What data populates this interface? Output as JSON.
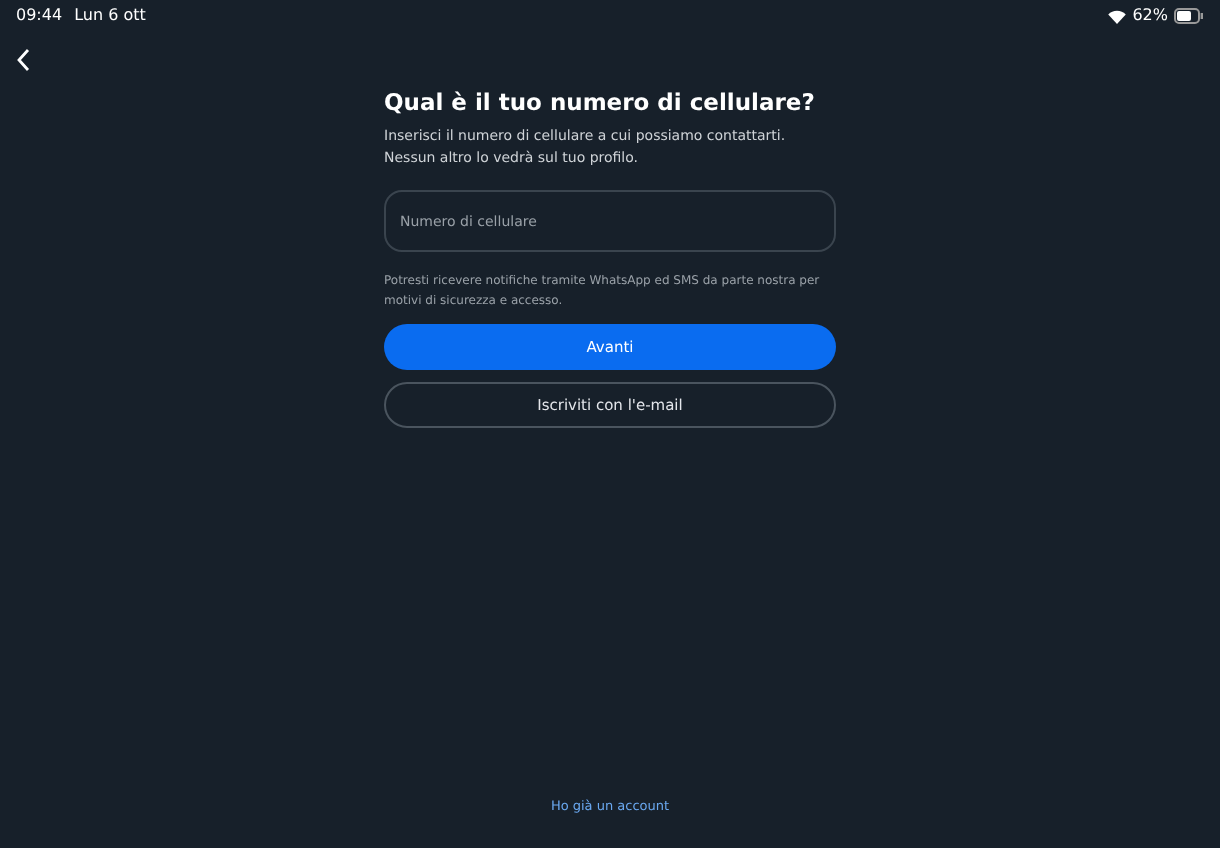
{
  "status_bar": {
    "time": "09:44",
    "date": "Lun 6 ott",
    "battery": "62%"
  },
  "title": "Qual è il tuo numero di cellulare?",
  "subtitle": "Inserisci il numero di cellulare a cui possiamo contattarti. Nessun altro lo vedrà sul tuo profilo.",
  "phone_field": {
    "placeholder": "Numero di cellulare"
  },
  "notice": "Potresti ricevere notifiche tramite WhatsApp ed SMS da parte nostra per motivi di sicurezza e accesso.",
  "buttons": [
    {
      "label": "Avanti",
      "kind": "primary"
    },
    {
      "label": "Iscriviti con l'e-mail",
      "kind": "outline"
    }
  ],
  "footer_link": "Ho già un account"
}
